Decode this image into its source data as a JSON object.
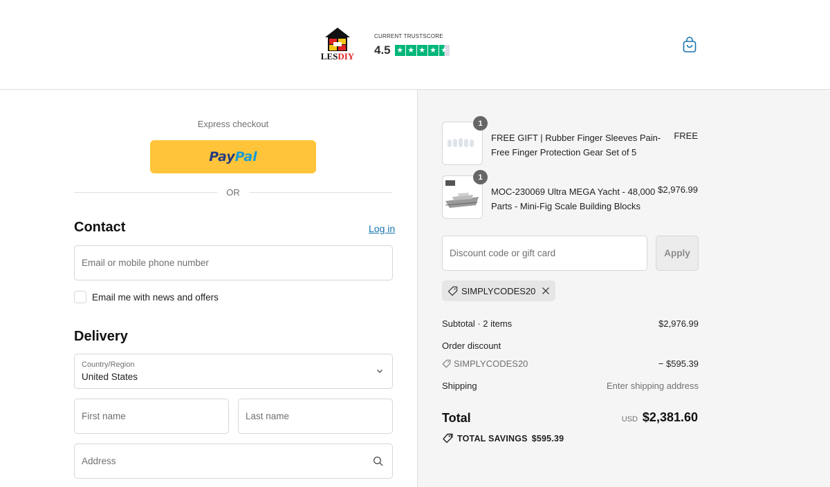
{
  "header": {
    "logo": {
      "text_les": "LES",
      "text_diy": "DIY"
    },
    "trustscore": {
      "label": "CURRENT TRUSTSCORE",
      "score": "4.5",
      "rating": 4.5,
      "max": 5,
      "star_color": "#00b67a"
    },
    "cart_icon": "shopping-bag-icon",
    "accent_color": "#1773b0"
  },
  "left": {
    "express_checkout_label": "Express checkout",
    "paypal": {
      "text_pay": "Pay",
      "text_pal": "Pal",
      "color": "#ffc439"
    },
    "or_label": "OR",
    "contact": {
      "title": "Contact",
      "login_link": "Log in",
      "email_placeholder": "Email or mobile phone number",
      "newsletter_label": "Email me with news and offers"
    },
    "delivery": {
      "title": "Delivery",
      "country_label": "Country/Region",
      "country_value": "United States",
      "first_name_placeholder": "First name",
      "last_name_placeholder": "Last name",
      "address_placeholder": "Address"
    }
  },
  "summary": {
    "items": [
      {
        "quantity": "1",
        "name": "FREE GIFT | Rubber Finger Sleeves Pain-Free Finger Protection Gear Set of 5",
        "price": "FREE"
      },
      {
        "quantity": "1",
        "name": "MOC-230069 Ultra MEGA Yacht - 48,000 Parts - Mini-Fig Scale Building Blocks",
        "price": "$2,976.99"
      }
    ],
    "discount_placeholder": "Discount code or gift card",
    "apply_label": "Apply",
    "applied_code": "SIMPLYCODES20",
    "subtotal_label": "Subtotal · 2 items",
    "subtotal_value": "$2,976.99",
    "order_discount_label": "Order discount",
    "order_discount_code": "SIMPLYCODES20",
    "order_discount_value": "− $595.39",
    "shipping_label": "Shipping",
    "shipping_value": "Enter shipping address",
    "total_label": "Total",
    "total_currency": "USD",
    "total_value": "$2,381.60",
    "savings_label": "TOTAL SAVINGS",
    "savings_value": "$595.39"
  }
}
